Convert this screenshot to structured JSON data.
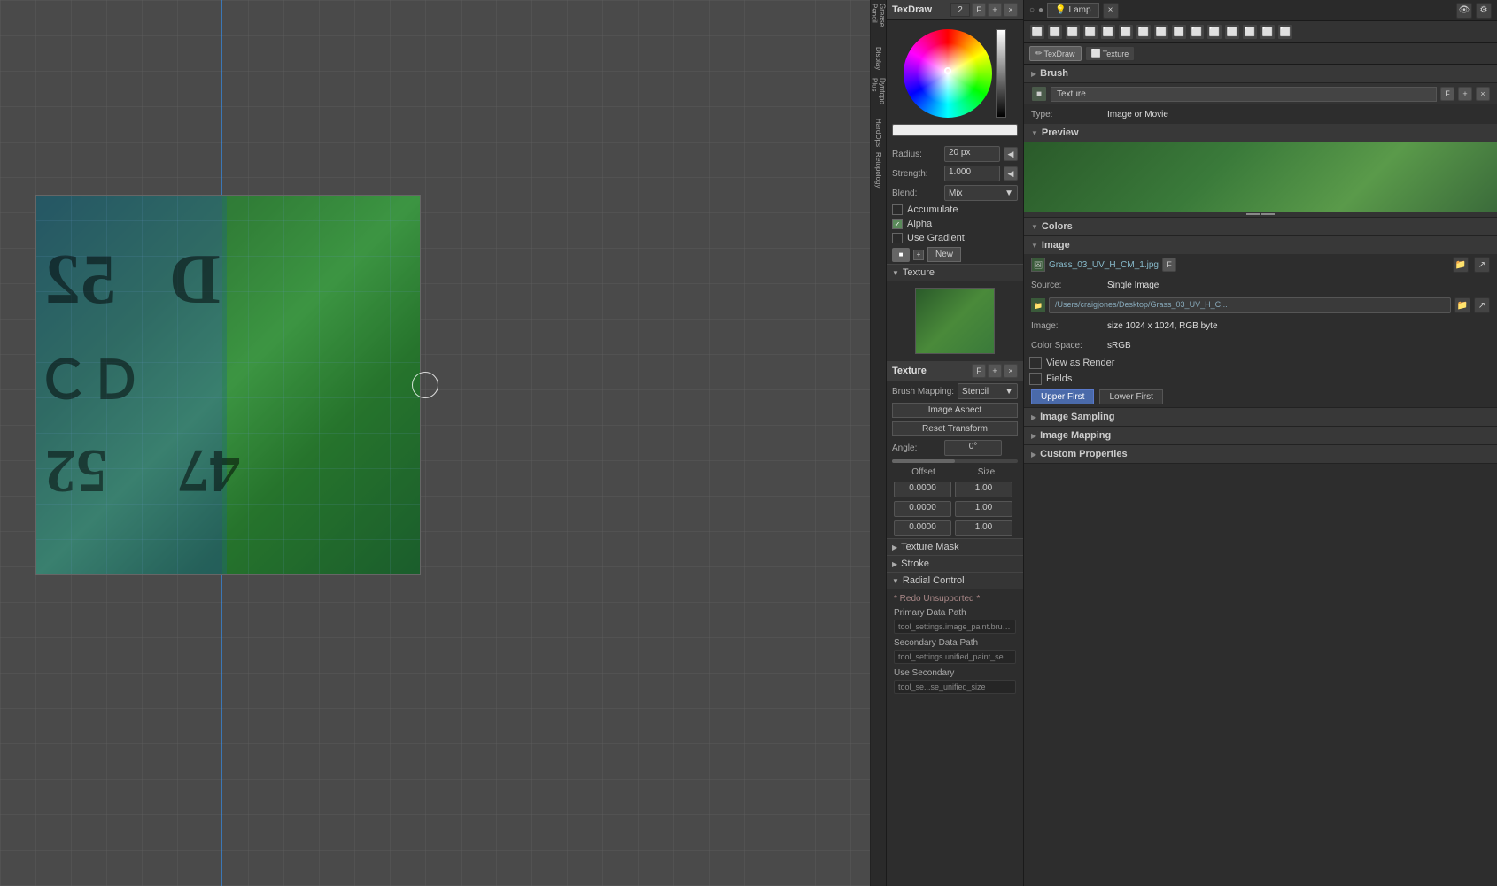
{
  "viewport": {
    "grid_color": "#4a4a4a"
  },
  "header": {
    "lamp_label": "Lamp",
    "close_icon": "×",
    "eye_icon": "👁",
    "dot_icon": "●"
  },
  "toolbar_strip": {
    "items": [
      {
        "label": "Grease Pencil",
        "id": "grease-pencil"
      },
      {
        "label": "Display",
        "id": "display"
      },
      {
        "label": "Dyntopo Plus",
        "id": "dyntopo-plus"
      },
      {
        "label": "HardOps",
        "id": "hardops"
      },
      {
        "label": "Retopology",
        "id": "retopology"
      }
    ]
  },
  "texdraw_panel": {
    "title": "TexDraw",
    "number": "2",
    "plus_btn": "+",
    "f_btn": "F",
    "close_btn": "×",
    "color_wheel": {
      "brightness_bar": true
    },
    "color_value_bar": "#eeeeee",
    "radius_label": "Radius:",
    "radius_value": "20 px",
    "strength_label": "Strength:",
    "strength_value": "1.000",
    "blend_label": "Blend:",
    "blend_value": "Mix",
    "accumulate_label": "Accumulate",
    "accumulate_checked": false,
    "alpha_label": "Alpha",
    "alpha_checked": true,
    "use_gradient_label": "Use Gradient",
    "use_gradient_checked": false,
    "new_btn_label": "New",
    "texture_section": {
      "title": "Texture",
      "brush_mapping_label": "Brush Mapping:",
      "brush_mapping_value": "Stencil",
      "image_aspect_label": "Image Aspect",
      "reset_transform_label": "Reset Transform",
      "angle_label": "Angle:",
      "angle_value": "0°",
      "offset_label": "Offset",
      "size_label": "Size",
      "offset_x": "0.0000",
      "offset_y": "0.0000",
      "offset_z": "0.0000",
      "size_x": "1.00",
      "size_y": "1.00",
      "size_z": "1.00"
    },
    "texture_mask_section": {
      "title": "Texture Mask"
    },
    "stroke_section": {
      "title": "Stroke"
    },
    "radial_control_section": {
      "title": "Radial Control",
      "redo_unsupported": "* Redo Unsupported *",
      "primary_data_path_label": "Primary Data Path",
      "primary_data_path_value": "tool_settings.image_paint.brus...",
      "secondary_data_path_label": "Secondary Data Path",
      "secondary_data_path_value": "tool_settings.unified_paint_setti...",
      "use_secondary_label": "Use Secondary",
      "use_secondary_value": "tool_se...se_unified_size"
    },
    "texture_sub_panel": {
      "title": "Texture",
      "f_btn": "F",
      "plus_btn": "+",
      "close_btn": "×"
    }
  },
  "right_panel": {
    "icon_row": {
      "buttons": [
        "⬜",
        "⬜",
        "⬜",
        "⬜",
        "⬜",
        "⬜",
        "⬜",
        "⬜",
        "⬜",
        "⬜",
        "⬜",
        "⬜",
        "⬜",
        "⬜",
        "⬜"
      ]
    },
    "mode_buttons": [
      {
        "label": "TexDraw",
        "icon": "✏",
        "active": true
      },
      {
        "label": "Texture",
        "icon": "⬜",
        "active": false
      }
    ],
    "brush_section": {
      "title": "Brush",
      "expand_arrow": "▶"
    },
    "texture_section": {
      "title": "Texture",
      "f_btn": "F",
      "plus_btn": "+",
      "close_btn": "×",
      "type_label": "Type:",
      "type_value": "Image or Movie",
      "preview_title": "Preview",
      "image_name": "Grass_03_UV_H_CM_1.jpg",
      "source_label": "Source:",
      "source_value": "Single Image",
      "file_path": "/Users/craigjones/Desktop/Grass_03_UV_H_C...",
      "image_size_label": "Image:",
      "image_size_value": "size 1024 x 1024, RGB byte",
      "color_space_label": "Color Space:",
      "color_space_value": "sRGB",
      "view_as_render_label": "View as Render",
      "view_as_render_checked": false,
      "fields_label": "Fields",
      "fields_checked": false,
      "upper_first_btn": "Upper First",
      "lower_first_btn": "Lower First"
    },
    "image_sampling_section": {
      "title": "Image Sampling",
      "expand_arrow": "▶"
    },
    "image_mapping_section": {
      "title": "Image Mapping",
      "expand_arrow": "▶"
    },
    "custom_properties_section": {
      "title": "Custom Properties",
      "expand_arrow": "▶"
    },
    "colors_section": {
      "title": "Colors",
      "expand_arrow": "▼"
    }
  }
}
